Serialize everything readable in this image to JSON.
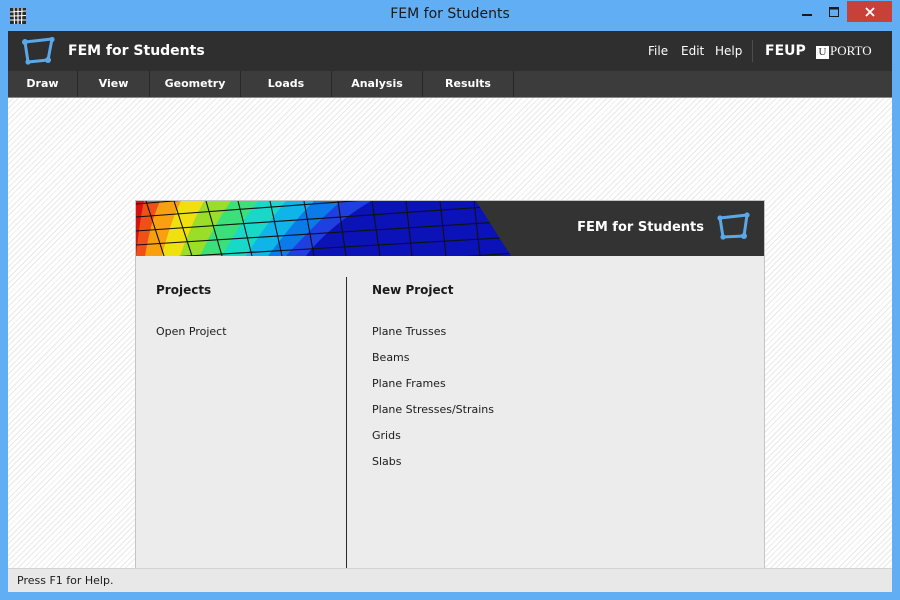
{
  "window": {
    "title": "FEM for Students",
    "controls": [
      "minimize",
      "maximize",
      "close"
    ]
  },
  "header": {
    "app_name": "FEM for Students",
    "menu": {
      "file": "File",
      "edit": "Edit",
      "help": "Help"
    },
    "brand_feup": "FEUP",
    "brand_uporto_u": "U",
    "brand_uporto_text": "PORTO"
  },
  "toolbar": {
    "items": [
      "Draw",
      "View",
      "Geometry",
      "Loads",
      "Analysis",
      "Results"
    ]
  },
  "start_panel": {
    "banner_title": "FEM for Students",
    "projects": {
      "title": "Projects",
      "items": [
        "Open Project"
      ]
    },
    "new_project": {
      "title": "New Project",
      "items": [
        "Plane Trusses",
        "Beams",
        "Plane Frames",
        "Plane Stresses/Strains",
        "Grids",
        "Slabs"
      ]
    }
  },
  "status": {
    "text": "Press F1 for Help."
  },
  "colors": {
    "window_frame": "#62aef5",
    "header_bg": "#2f2f2f",
    "toolbar_bg": "#3c3c3c",
    "close_button": "#c74139",
    "logo_accent": "#5aa8e8"
  },
  "icons": {
    "app": "grid-mesh-icon",
    "logo": "quadrilateral-element-icon"
  }
}
